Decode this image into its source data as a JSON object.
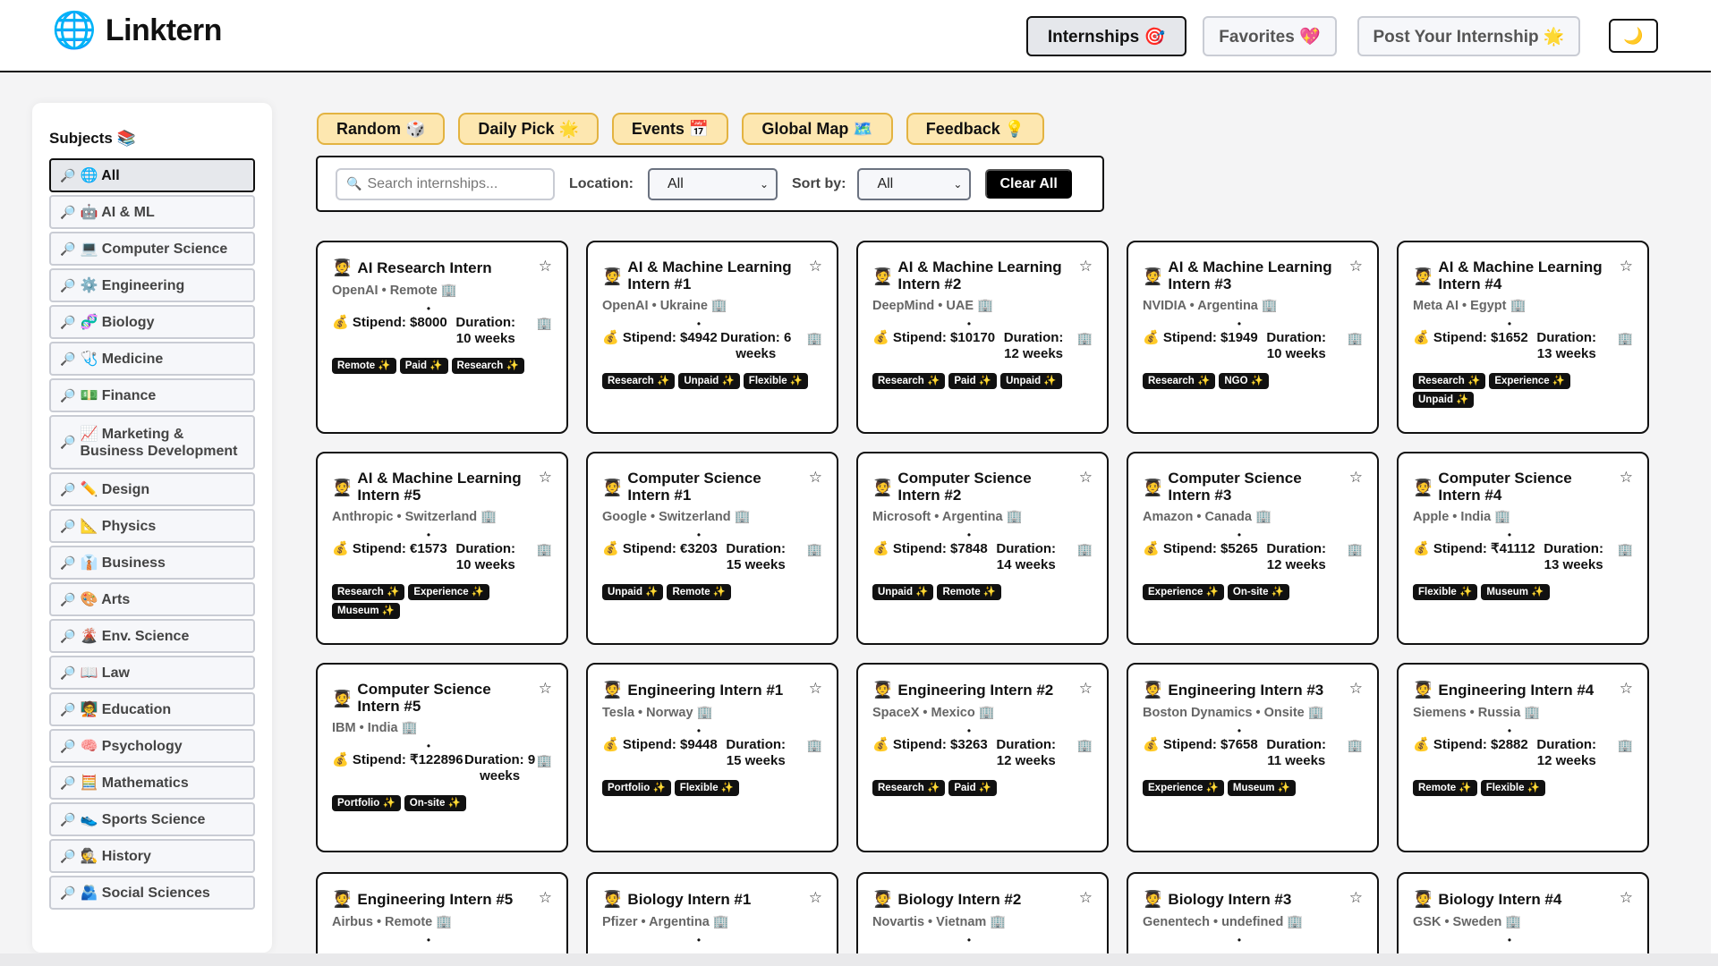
{
  "app": {
    "logo_icon": "🌐",
    "title": "Linktern"
  },
  "nav": {
    "internships": "Internships 🎯",
    "favorites": "Favorites 💖",
    "post": "Post Your Internship 🌟",
    "theme": "🌙"
  },
  "sidebar": {
    "title": "Subjects 📚",
    "items": [
      {
        "label": "🌐 All"
      },
      {
        "label": "🤖 AI & ML"
      },
      {
        "label": "💻 Computer Science"
      },
      {
        "label": "⚙️ Engineering"
      },
      {
        "label": "🧬 Biology"
      },
      {
        "label": "🩺 Medicine"
      },
      {
        "label": "💵 Finance"
      },
      {
        "label": "📈 Marketing & Business Development"
      },
      {
        "label": "✏️ Design"
      },
      {
        "label": "📐 Physics"
      },
      {
        "label": "👔 Business"
      },
      {
        "label": "🎨 Arts"
      },
      {
        "label": "🌋 Env. Science"
      },
      {
        "label": "📖 Law"
      },
      {
        "label": "🧑‍🏫 Education"
      },
      {
        "label": "🧠 Psychology"
      },
      {
        "label": "🧮 Mathematics"
      },
      {
        "label": "👟 Sports Science"
      },
      {
        "label": "🕵️ History"
      },
      {
        "label": "🫂 Social Sciences"
      }
    ],
    "item_icon": "🔎"
  },
  "quick": [
    "Random 🎲",
    "Daily Pick 🌟",
    "Events 📅",
    "Global Map 🗺️",
    "Feedback 💡"
  ],
  "filters": {
    "search_placeholder": "Search internships...",
    "location_label": "Location:",
    "location_value": "All",
    "sort_label": "Sort by:",
    "sort_value": "All",
    "clear": "Clear All"
  },
  "card_icons": {
    "person": "🧑‍🎓",
    "star": "☆",
    "money": "💰",
    "building": "🏢",
    "bullet": "•"
  },
  "cards": [
    {
      "title": "AI Research Intern",
      "sub": "OpenAI • Remote",
      "stipend": "Stipend: $8000",
      "duration": "Duration: 10 weeks",
      "tags": [
        "Remote ✨",
        "Paid ✨",
        "Research ✨"
      ]
    },
    {
      "title": "AI & Machine Learning Intern #1",
      "sub": "OpenAI • Ukraine",
      "stipend": "Stipend: $4942",
      "duration": "Duration: 6 weeks",
      "tags": [
        "Research ✨",
        "Unpaid ✨",
        "Flexible ✨"
      ]
    },
    {
      "title": "AI & Machine Learning Intern #2",
      "sub": "DeepMind • UAE",
      "stipend": "Stipend: $10170",
      "duration": "Duration: 12 weeks",
      "tags": [
        "Research ✨",
        "Paid ✨",
        "Unpaid ✨"
      ]
    },
    {
      "title": "AI & Machine Learning Intern #3",
      "sub": "NVIDIA • Argentina",
      "stipend": "Stipend: $1949",
      "duration": "Duration: 10 weeks",
      "tags": [
        "Research ✨",
        "NGO ✨"
      ]
    },
    {
      "title": "AI & Machine Learning Intern #4",
      "sub": "Meta AI • Egypt",
      "stipend": "Stipend: $1652",
      "duration": "Duration: 13 weeks",
      "tags": [
        "Research ✨",
        "Experience ✨",
        "Unpaid ✨"
      ]
    },
    {
      "title": "AI & Machine Learning Intern #5",
      "sub": "Anthropic • Switzerland",
      "stipend": "Stipend: €1573",
      "duration": "Duration: 10 weeks",
      "tags": [
        "Research ✨",
        "Experience ✨",
        "Museum ✨"
      ]
    },
    {
      "title": "Computer Science Intern #1",
      "sub": "Google • Switzerland",
      "stipend": "Stipend: €3203",
      "duration": "Duration: 15 weeks",
      "tags": [
        "Unpaid ✨",
        "Remote ✨"
      ]
    },
    {
      "title": "Computer Science Intern #2",
      "sub": "Microsoft • Argentina",
      "stipend": "Stipend: $7848",
      "duration": "Duration: 14 weeks",
      "tags": [
        "Unpaid ✨",
        "Remote ✨"
      ]
    },
    {
      "title": "Computer Science Intern #3",
      "sub": "Amazon • Canada",
      "stipend": "Stipend: $5265",
      "duration": "Duration: 12 weeks",
      "tags": [
        "Experience ✨",
        "On-site ✨"
      ]
    },
    {
      "title": "Computer Science Intern #4",
      "sub": "Apple • India",
      "stipend": "Stipend: ₹41112",
      "duration": "Duration: 13 weeks",
      "tags": [
        "Flexible ✨",
        "Museum ✨"
      ]
    },
    {
      "title": "Computer Science Intern #5",
      "sub": "IBM • India",
      "stipend": "Stipend: ₹122896",
      "duration": "Duration: 9 weeks",
      "tags": [
        "Portfolio ✨",
        "On-site ✨"
      ]
    },
    {
      "title": "Engineering Intern #1",
      "sub": "Tesla • Norway",
      "stipend": "Stipend: $9448",
      "duration": "Duration: 15 weeks",
      "tags": [
        "Portfolio ✨",
        "Flexible ✨"
      ]
    },
    {
      "title": "Engineering Intern #2",
      "sub": "SpaceX • Mexico",
      "stipend": "Stipend: $3263",
      "duration": "Duration: 12 weeks",
      "tags": [
        "Research ✨",
        "Paid ✨"
      ]
    },
    {
      "title": "Engineering Intern #3",
      "sub": "Boston Dynamics • Onsite",
      "stipend": "Stipend: $7658",
      "duration": "Duration: 11 weeks",
      "tags": [
        "Experience ✨",
        "Museum ✨"
      ]
    },
    {
      "title": "Engineering Intern #4",
      "sub": "Siemens • Russia",
      "stipend": "Stipend: $2882",
      "duration": "Duration: 12 weeks",
      "tags": [
        "Remote ✨",
        "Flexible ✨"
      ]
    },
    {
      "title": "Engineering Intern #5",
      "sub": "Airbus • Remote",
      "stipend": "",
      "duration": "",
      "tags": []
    },
    {
      "title": "Biology Intern #1",
      "sub": "Pfizer • Argentina",
      "stipend": "",
      "duration": "",
      "tags": []
    },
    {
      "title": "Biology Intern #2",
      "sub": "Novartis • Vietnam",
      "stipend": "",
      "duration": "",
      "tags": []
    },
    {
      "title": "Biology Intern #3",
      "sub": "Genentech • undefined",
      "stipend": "",
      "duration": "",
      "tags": []
    },
    {
      "title": "Biology Intern #4",
      "sub": "GSK • Sweden",
      "stipend": "",
      "duration": "",
      "tags": []
    }
  ]
}
